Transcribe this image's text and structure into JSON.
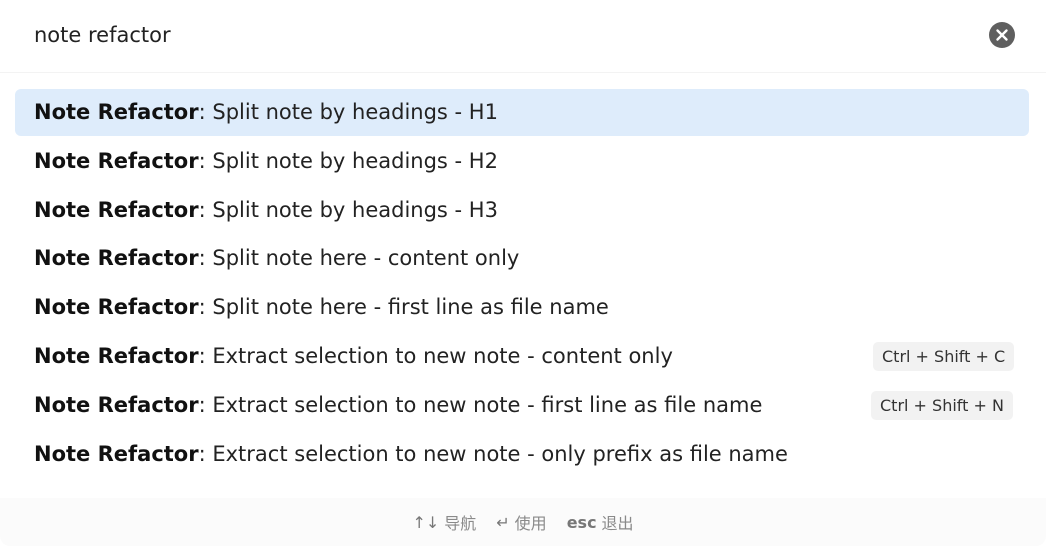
{
  "search": {
    "value": "note refactor",
    "clear_icon": "close-icon"
  },
  "results": [
    {
      "prefix": "Note Refactor",
      "separator": ": ",
      "label": "Split note by headings - H1",
      "hotkey": "",
      "selected": true
    },
    {
      "prefix": "Note Refactor",
      "separator": ": ",
      "label": "Split note by headings - H2",
      "hotkey": "",
      "selected": false
    },
    {
      "prefix": "Note Refactor",
      "separator": ": ",
      "label": "Split note by headings - H3",
      "hotkey": "",
      "selected": false
    },
    {
      "prefix": "Note Refactor",
      "separator": ": ",
      "label": "Split note here - content only",
      "hotkey": "",
      "selected": false
    },
    {
      "prefix": "Note Refactor",
      "separator": ": ",
      "label": "Split note here - first line as file name",
      "hotkey": "",
      "selected": false
    },
    {
      "prefix": "Note Refactor",
      "separator": ": ",
      "label": "Extract selection to new note - content only",
      "hotkey": "Ctrl + Shift + C",
      "selected": false
    },
    {
      "prefix": "Note Refactor",
      "separator": ": ",
      "label": "Extract selection to new note - first line as file name",
      "hotkey": "Ctrl + Shift + N",
      "selected": false
    },
    {
      "prefix": "Note Refactor",
      "separator": ": ",
      "label": "Extract selection to new note - only prefix as file name",
      "hotkey": "",
      "selected": false
    }
  ],
  "footer": {
    "navigate_key": "↑↓",
    "navigate_label": "导航",
    "use_key": "↵",
    "use_label": "使用",
    "esc_key": "esc",
    "esc_label": "退出"
  },
  "colors": {
    "selected_background": "#deecfb",
    "hotkey_background": "#f2f2f2",
    "clear_button": "#5f5f5f",
    "footer_background": "#fbfbfb"
  }
}
